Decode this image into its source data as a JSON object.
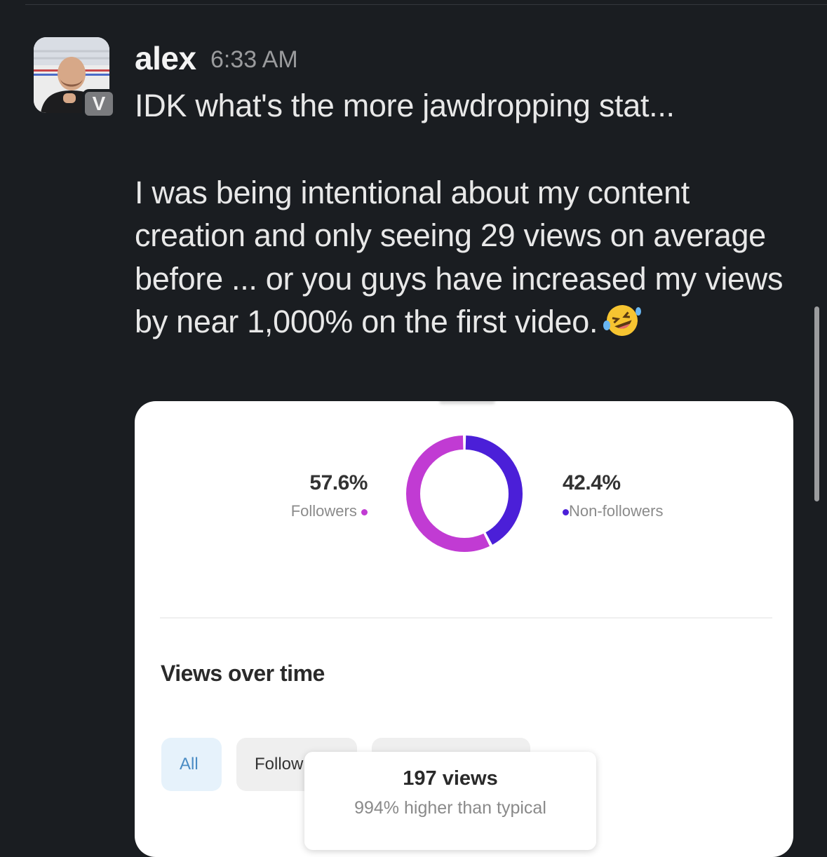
{
  "message": {
    "author": "alex",
    "time": "6:33 AM",
    "badge": "V",
    "line1": "IDK what's the more jawdropping stat...",
    "paragraph": "I was being intentional about my content creation and only seeing 29 views on average before ... or you guys have increased my views by near 1,000% on the first video.",
    "emoji": "rolling-on-the-floor-laughing"
  },
  "card": {
    "followers": {
      "pct": "57.6%",
      "label": "Followers",
      "value": 57.6,
      "color": "#c13bd3"
    },
    "non_followers": {
      "pct": "42.4%",
      "label": "Non-followers",
      "value": 42.4,
      "color": "#4b1fd8"
    },
    "section_title": "Views over time",
    "chips": [
      "All",
      "Follow"
    ],
    "tooltip": {
      "views": "197 views",
      "sub": "994% higher than typical"
    }
  }
}
